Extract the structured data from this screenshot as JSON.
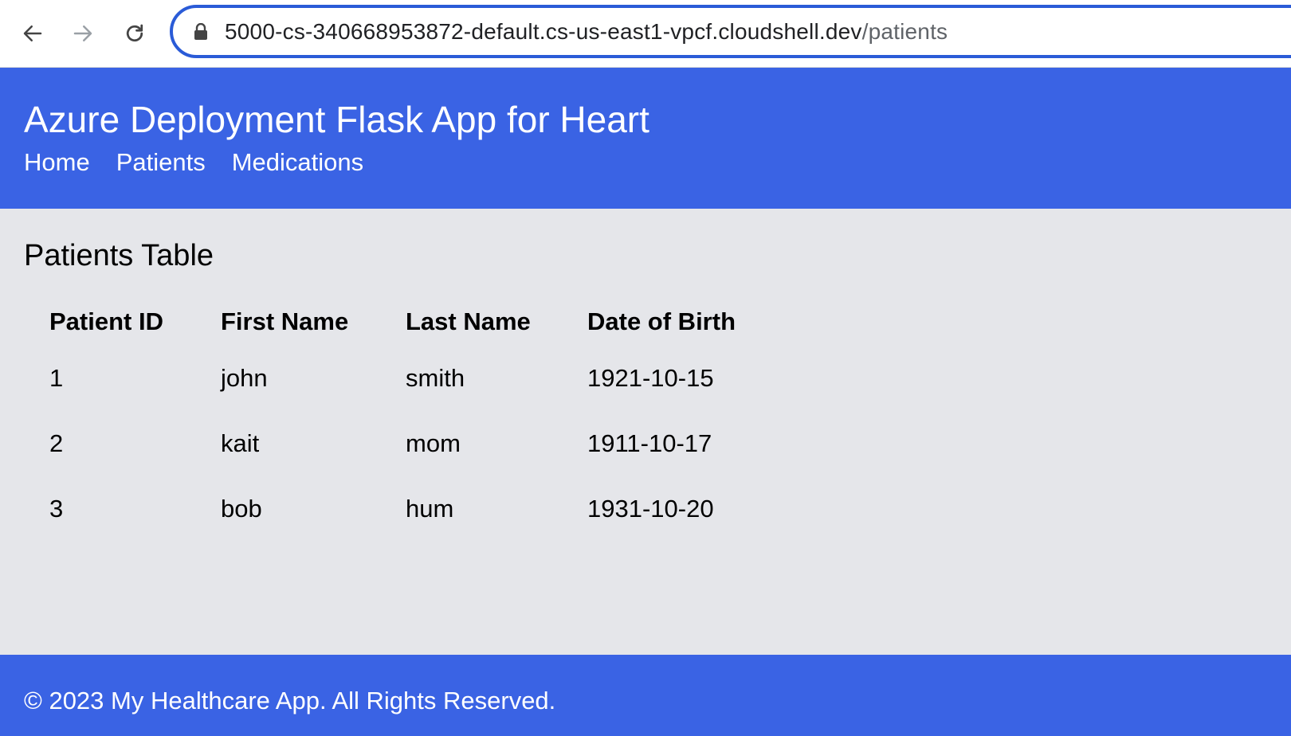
{
  "browser": {
    "url_host": "5000-cs-340668953872-default.cs-us-east1-vpcf.cloudshell.dev",
    "url_path": "/patients",
    "icons": {
      "back": "back-arrow-icon",
      "forward": "forward-arrow-icon",
      "reload": "reload-icon",
      "lock": "lock-icon"
    }
  },
  "header": {
    "title": "Azure Deployment Flask App for Heart",
    "nav": [
      "Home",
      "Patients",
      "Medications"
    ]
  },
  "main": {
    "title": "Patients Table",
    "columns": [
      "Patient ID",
      "First Name",
      "Last Name",
      "Date of Birth"
    ],
    "rows": [
      [
        "1",
        "john",
        "smith",
        "1921-10-15"
      ],
      [
        "2",
        "kait",
        "mom",
        "1911-10-17"
      ],
      [
        "3",
        "bob",
        "hum",
        "1931-10-20"
      ]
    ]
  },
  "footer": {
    "text": "© 2023 My Healthcare App. All Rights Reserved."
  },
  "colors": {
    "brand": "#3a63e4",
    "content_bg": "#e5e6ea",
    "url_focus_ring": "#2a5bd7"
  }
}
